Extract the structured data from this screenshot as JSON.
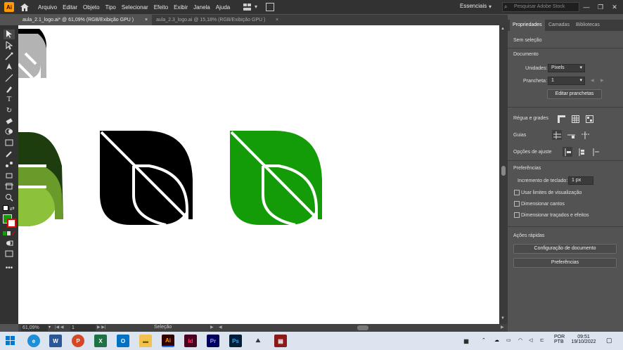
{
  "app": {
    "logo_text": "Ai",
    "accent": "#ff9a00"
  },
  "menu": [
    "Arquivo",
    "Editar",
    "Objeto",
    "Tipo",
    "Selecionar",
    "Efeito",
    "Exibir",
    "Janela",
    "Ajuda"
  ],
  "workspace": "Essenciais",
  "search_placeholder": "Pesquisar Adobe Stock",
  "tabs": [
    {
      "label": "aula_2.1_logo.ai* @ 61,09% (RGB/Exibição GPU )",
      "close": "×"
    },
    {
      "label": "aula_2.3_logo.ai @ 15,18% (RGB/Exibição GPU )",
      "close": "×"
    }
  ],
  "panel": {
    "tabs": [
      "Propriedades",
      "Camadas",
      "Bibliotecas"
    ],
    "no_selection": "Sem seleção",
    "document_title": "Documento",
    "units_label": "Unidades:",
    "units_value": "Pixels",
    "artboard_label": "Prancheta:",
    "artboard_value": "1",
    "edit_artboards": "Editar pranchetas",
    "rulers_label": "Régua e grades",
    "guides_label": "Guias",
    "snap_label": "Opções de ajuste",
    "prefs_title": "Preferências",
    "keyboard_increment_label": "Incremento de teclado:",
    "keyboard_increment_value": "1 px",
    "checkboxes": [
      "Usar limites de visualização",
      "Dimensionar cantos",
      "Dimensionar traçados e efeitos"
    ],
    "quick_actions_title": "Ações rápidas",
    "doc_setup_button": "Configuração de documento",
    "prefs_button": "Preferências"
  },
  "status": {
    "zoom": "61,09%",
    "artboard": "1",
    "tool": "Seleção"
  },
  "colors": {
    "green": "#139c07",
    "black": "#000000",
    "dark_green": "#1e3d0f",
    "olive": "#6a9a2a",
    "light_green": "#8cc13a",
    "gray": "#b3b3b3"
  },
  "taskbar": {
    "lang1": "POR",
    "lang2": "PTB",
    "time": "09:51",
    "date": "19/10/2022"
  }
}
